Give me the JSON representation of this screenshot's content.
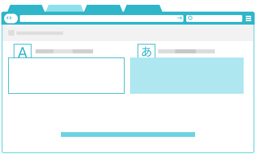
{
  "toolbar": {
    "back_forward_glyph": "‹›",
    "go_glyph": "→",
    "search_icon": "search-icon",
    "menu_icon": "hamburger-menu-icon"
  },
  "tabs": [
    {
      "state": "inactive"
    },
    {
      "state": "active"
    },
    {
      "state": "inactive"
    },
    {
      "state": "inactive"
    }
  ],
  "translator": {
    "source_language_badge": "A",
    "target_language_badge": "あ"
  },
  "colors": {
    "accent": "#2fb6c9",
    "active_tab": "#8fe0ec",
    "target_fill": "#aee7f0",
    "bottom_bar": "#6cd3e2"
  }
}
